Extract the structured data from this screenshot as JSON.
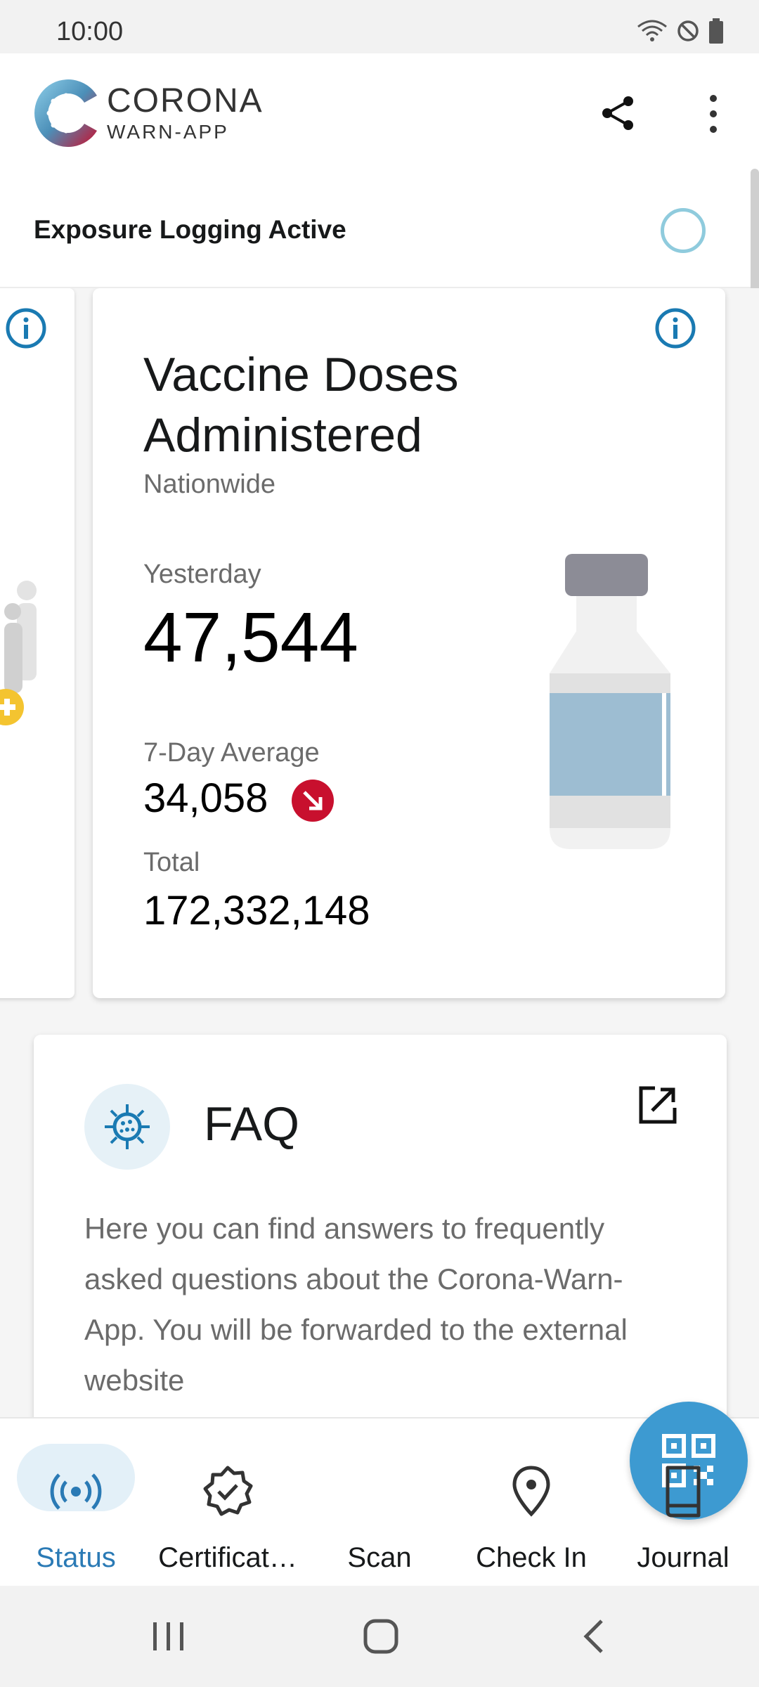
{
  "status_bar": {
    "time": "10:00"
  },
  "header": {
    "brand_line1": "CORONA",
    "brand_line2": "WARN-APP"
  },
  "exposure": {
    "label": "Exposure Logging Active"
  },
  "vaccine_card": {
    "title": "Vaccine Doses Administered",
    "subtitle": "Nationwide",
    "yesterday_label": "Yesterday",
    "yesterday_value": "47,544",
    "average_label": "7-Day Average",
    "average_value": "34,058",
    "total_label": "Total",
    "total_value": "172,332,148",
    "trend": "decreasing"
  },
  "faq": {
    "title": "FAQ",
    "body": "Here you can find answers to frequently asked questions about the Corona-Warn-App. You will be forwarded to the external website"
  },
  "bottom_nav": {
    "status": "Status",
    "certificates": "Certificat…",
    "scan": "Scan",
    "check_in": "Check In",
    "journal": "Journal"
  },
  "colors": {
    "accent": "#3d9ad1",
    "active_nav": "#2a7ab5",
    "trend_down": "#c8102e",
    "ring": "#8fcbdd"
  }
}
